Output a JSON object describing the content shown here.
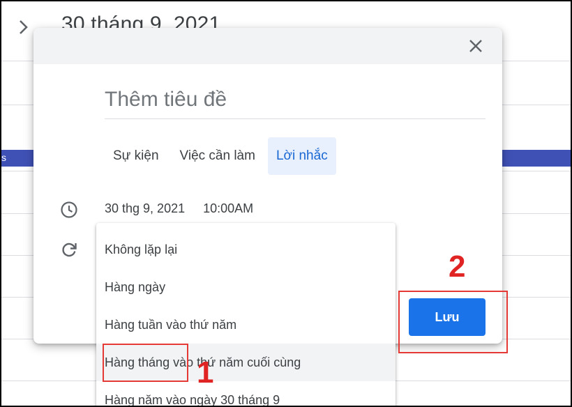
{
  "background": {
    "header_date": "30 tháng 9, 2021",
    "band_text": "s"
  },
  "dialog": {
    "title_placeholder": "Thêm tiêu đề",
    "tabs": [
      {
        "label": "Sự kiện",
        "active": false
      },
      {
        "label": "Việc cần làm",
        "active": false
      },
      {
        "label": "Lời nhắc",
        "active": true
      }
    ],
    "date": "30 thg 9, 2021",
    "time": "10:00AM",
    "save_label": "Lưu",
    "icons": {
      "close": "close-icon",
      "time": "clock-icon",
      "repeat": "repeat-icon"
    }
  },
  "repeat_menu": {
    "items": [
      "Không lặp lại",
      "Hàng ngày",
      "Hàng tuần vào thứ năm",
      "Hàng tháng vào thứ năm cuối cùng",
      "Hàng năm vào ngày 30 tháng 9"
    ],
    "highlighted_index": 3
  },
  "annotations": {
    "marker_1": "1",
    "marker_2": "2"
  },
  "colors": {
    "accent": "#1a73e8",
    "annotation": "#e53935",
    "band": "#3f51b5"
  }
}
